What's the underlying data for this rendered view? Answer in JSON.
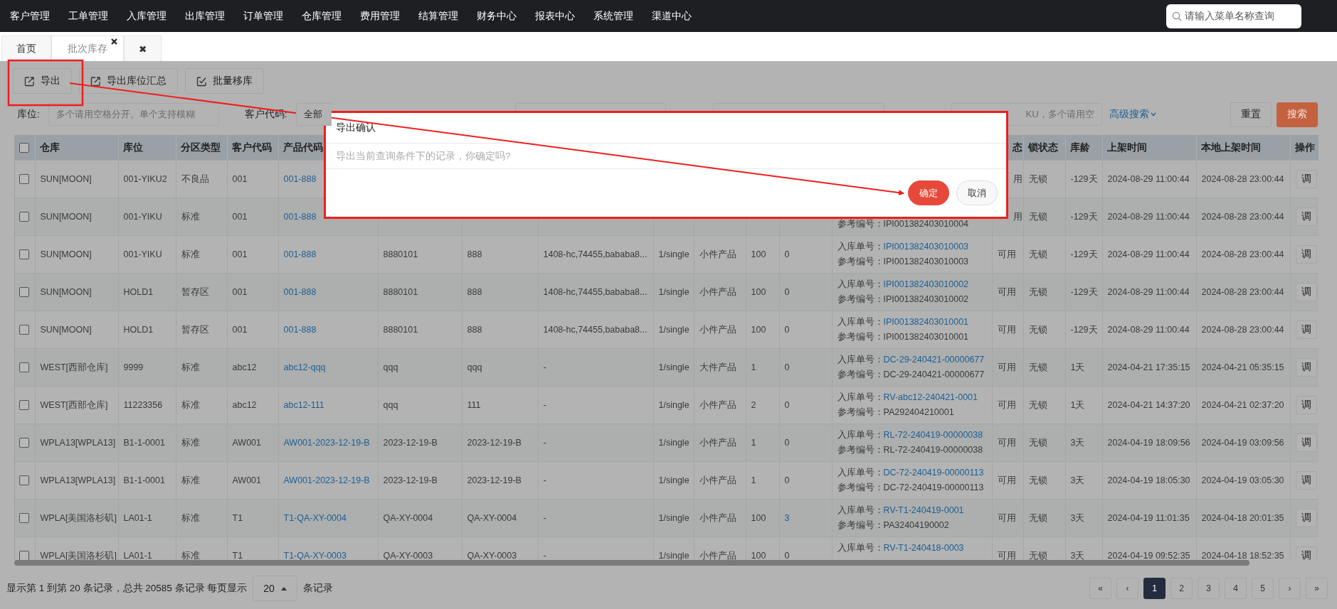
{
  "nav": {
    "items": [
      "客户管理",
      "工单管理",
      "入库管理",
      "出库管理",
      "订单管理",
      "仓库管理",
      "费用管理",
      "结算管理",
      "财务中心",
      "报表中心",
      "系统管理",
      "渠道中心"
    ],
    "search": {
      "placeholder": "请输入菜单名称查询"
    }
  },
  "tabs": [
    {
      "label": "首页",
      "selected": false,
      "closable": false
    },
    {
      "label": "批次库存",
      "selected": true,
      "closable": true
    },
    {
      "label": "✖",
      "selected": false,
      "closable": false
    }
  ],
  "toolbar": [
    {
      "label": "导出",
      "kind": "export"
    },
    {
      "label": "导出库位汇总",
      "kind": "export"
    },
    {
      "label": "批量移库",
      "kind": "move"
    }
  ],
  "filters": [
    {
      "kind": "input",
      "label": "库位:",
      "placeholder": "多个请用空格分开。单个支持模糊"
    },
    {
      "kind": "select",
      "label": "客户代码:",
      "value": "全部"
    },
    {
      "kind": "input"
    },
    {
      "kind": "input"
    },
    {
      "kind": "input",
      "placeholder": "KU，多个请用空"
    }
  ],
  "advanced_search": "高级搜索",
  "filter_buttons": [
    {
      "label": "重置",
      "kind": "plain"
    },
    {
      "label": "搜索",
      "kind": "primary"
    }
  ],
  "table": {
    "all_checked": false,
    "columns": [
      {
        "label": "仓库"
      },
      {
        "label": "库位"
      },
      {
        "label": "分区类型"
      },
      {
        "label": "客户代码"
      },
      {
        "label": "产品代码"
      },
      null,
      null,
      null,
      null,
      null,
      null,
      null,
      null,
      {
        "label": "态",
        "kind": "partial"
      },
      {
        "label": "锁状态"
      },
      {
        "label": "库龄"
      },
      {
        "label": "上架时间"
      },
      {
        "label": "本地上架时间"
      },
      {
        "label": "操作"
      }
    ],
    "rows": [
      {
        "checked": false,
        "cells": [
          "SUN[MOON]",
          "001-YIKU2",
          "不良品",
          "001",
          {
            "kind": "link",
            "text": "001-888"
          },
          null,
          null,
          null,
          null,
          null,
          null,
          null,
          null,
          {
            "kind": "partial",
            "text": "用"
          },
          "无锁",
          "-129天",
          "2024-08-29 11:00:44",
          "2024-08-28 23:00:44",
          {
            "kind": "button",
            "text": "调"
          }
        ]
      },
      {
        "checked": false,
        "cells": [
          "SUN[MOON]",
          "001-YIKU",
          "标准",
          "001",
          {
            "kind": "link",
            "text": "001-888"
          },
          null,
          null,
          null,
          null,
          null,
          null,
          null,
          {
            "kind": "doc",
            "ref_label": "参考编号：",
            "ref_no": "IPI001382403010004"
          },
          {
            "kind": "partial",
            "text": "用"
          },
          "无锁",
          "-129天",
          "2024-08-29 11:00:44",
          "2024-08-28 23:00:44",
          {
            "kind": "button",
            "text": "调"
          }
        ]
      },
      {
        "checked": false,
        "cells": [
          "SUN[MOON]",
          "001-YIKU",
          "标准",
          "001",
          {
            "kind": "link",
            "text": "001-888"
          },
          "8880101",
          "888",
          "1408-hc,74455,bababa8...",
          "1/single",
          "小件产品",
          "100",
          "0",
          {
            "kind": "doc",
            "in_label": "入库单号：",
            "in_no": "IPI001382403010003",
            "ref_label": "参考编号：",
            "ref_no": "IPI001382403010003"
          },
          "可用",
          "无锁",
          "-129天",
          "2024-08-29 11:00:44",
          "2024-08-28 23:00:44",
          {
            "kind": "button",
            "text": "调"
          }
        ]
      },
      {
        "checked": false,
        "cells": [
          "SUN[MOON]",
          "HOLD1",
          "暂存区",
          "001",
          {
            "kind": "link",
            "text": "001-888"
          },
          "8880101",
          "888",
          "1408-hc,74455,bababa8...",
          "1/single",
          "小件产品",
          "100",
          "0",
          {
            "kind": "doc",
            "in_label": "入库单号：",
            "in_no": "IPI001382403010002",
            "ref_label": "参考编号：",
            "ref_no": "IPI001382403010002"
          },
          "可用",
          "无锁",
          "-129天",
          "2024-08-29 11:00:44",
          "2024-08-28 23:00:44",
          {
            "kind": "button",
            "text": "调"
          }
        ]
      },
      {
        "checked": false,
        "cells": [
          "SUN[MOON]",
          "HOLD1",
          "暂存区",
          "001",
          {
            "kind": "link",
            "text": "001-888"
          },
          "8880101",
          "888",
          "1408-hc,74455,bababa8...",
          "1/single",
          "小件产品",
          "100",
          "0",
          {
            "kind": "doc",
            "in_label": "入库单号：",
            "in_no": "IPI001382403010001",
            "ref_label": "参考编号：",
            "ref_no": "IPI001382403010001"
          },
          "可用",
          "无锁",
          "-129天",
          "2024-08-29 11:00:44",
          "2024-08-28 23:00:44",
          {
            "kind": "button",
            "text": "调"
          }
        ]
      },
      {
        "checked": false,
        "cells": [
          "WEST[西部仓库]",
          "9999",
          "标准",
          "abc12",
          {
            "kind": "link",
            "text": "abc12-qqq"
          },
          "qqq",
          "qqq",
          "-",
          "1/single",
          "大件产品",
          "1",
          "0",
          {
            "kind": "doc",
            "in_label": "入库单号：",
            "in_no": "DC-29-240421-00000677",
            "ref_label": "参考编号：",
            "ref_no": "DC-29-240421-00000677"
          },
          "可用",
          "无锁",
          "1天",
          "2024-04-21 17:35:15",
          "2024-04-21 05:35:15",
          {
            "kind": "button",
            "text": "调"
          }
        ]
      },
      {
        "checked": false,
        "cells": [
          "WEST[西部仓库]",
          "11223356",
          "标准",
          "abc12",
          {
            "kind": "link",
            "text": "abc12-111"
          },
          "qqq",
          "111",
          "-",
          "1/single",
          "小件产品",
          "2",
          "0",
          {
            "kind": "doc",
            "in_label": "入库单号：",
            "in_no": "RV-abc12-240421-0001",
            "ref_label": "参考编号：",
            "ref_no": "PA292404210001"
          },
          "可用",
          "无锁",
          "1天",
          "2024-04-21 14:37:20",
          "2024-04-21 02:37:20",
          {
            "kind": "button",
            "text": "调"
          }
        ]
      },
      {
        "checked": false,
        "cells": [
          "WPLA13[WPLA13]",
          "B1-1-0001",
          "标准",
          "AW001",
          {
            "kind": "link",
            "text": "AW001-2023-12-19-B"
          },
          "2023-12-19-B",
          "2023-12-19-B",
          "-",
          "1/single",
          "小件产品",
          "1",
          "0",
          {
            "kind": "doc",
            "in_label": "入库单号：",
            "in_no": "RL-72-240419-00000038",
            "ref_label": "参考编号：",
            "ref_no": "RL-72-240419-00000038"
          },
          "可用",
          "无锁",
          "3天",
          "2024-04-19 18:09:56",
          "2024-04-19 03:09:56",
          {
            "kind": "button",
            "text": "调"
          }
        ]
      },
      {
        "checked": false,
        "cells": [
          "WPLA13[WPLA13]",
          "B1-1-0001",
          "标准",
          "AW001",
          {
            "kind": "link",
            "text": "AW001-2023-12-19-B"
          },
          "2023-12-19-B",
          "2023-12-19-B",
          "-",
          "1/single",
          "小件产品",
          "1",
          "0",
          {
            "kind": "doc",
            "in_label": "入库单号：",
            "in_no": "DC-72-240419-00000113",
            "ref_label": "参考编号：",
            "ref_no": "DC-72-240419-00000113"
          },
          "可用",
          "无锁",
          "3天",
          "2024-04-19 18:05:30",
          "2024-04-19 03:05:30",
          {
            "kind": "button",
            "text": "调"
          }
        ]
      },
      {
        "checked": false,
        "cells": [
          "WPLA[美国洛杉矶]",
          "LA01-1",
          "标准",
          "T1",
          {
            "kind": "link",
            "text": "T1-QA-XY-0004"
          },
          "QA-XY-0004",
          "QA-XY-0004",
          "-",
          "1/single",
          "小件产品",
          "100",
          {
            "kind": "link",
            "text": "3"
          },
          {
            "kind": "doc",
            "in_label": "入库单号：",
            "in_no": "RV-T1-240419-0001",
            "ref_label": "参考编号：",
            "ref_no": "PA32404190002"
          },
          "可用",
          "无锁",
          "3天",
          "2024-04-19 11:01:35",
          "2024-04-18 20:01:35",
          {
            "kind": "button",
            "text": "调"
          }
        ]
      },
      {
        "checked": false,
        "cells": [
          "WPLA[美国洛杉矶]",
          "LA01-1",
          "标准",
          "T1",
          {
            "kind": "link",
            "text": "T1-QA-XY-0003"
          },
          "QA-XY-0003",
          "QA-XY-0003",
          "-",
          "1/single",
          "小件产品",
          "100",
          "0",
          {
            "kind": "doc",
            "in_label": "入库单号：",
            "in_no": "RV-T1-240418-0003"
          },
          "可用",
          "无锁",
          "3天",
          "2024-04-19 09:52:35",
          "2024-04-18 18:52:35",
          {
            "kind": "button",
            "text": "调"
          }
        ]
      }
    ]
  },
  "dialog": {
    "title": "导出确认",
    "message": "导出当前查询条件下的记录，你确定吗?",
    "buttons": [
      {
        "label": "确定",
        "kind": "primary"
      },
      {
        "label": "取消",
        "kind": "plain"
      }
    ]
  },
  "footer": {
    "summary": "显示第 1 到第 20 条记录，总共 20585 条记录 每页显示",
    "page_size": "20",
    "suffix": "条记录"
  },
  "pagination": [
    {
      "label": "«",
      "selected": false
    },
    {
      "label": "‹",
      "selected": false
    },
    {
      "label": "1",
      "selected": true
    },
    {
      "label": "2",
      "selected": false
    },
    {
      "label": "3",
      "selected": false
    },
    {
      "label": "4",
      "selected": false
    },
    {
      "label": "5",
      "selected": false
    },
    {
      "label": "›",
      "selected": false
    },
    {
      "label": "»",
      "selected": false
    }
  ]
}
